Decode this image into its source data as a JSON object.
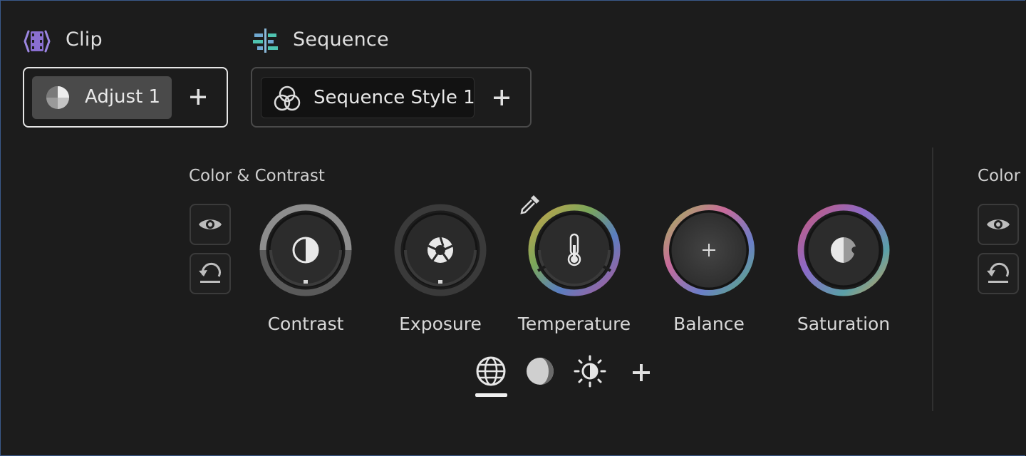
{
  "header": {
    "clip_label": "Clip",
    "sequence_label": "Sequence"
  },
  "clip_group": {
    "chip_label": "Adjust 1",
    "add_label": "+"
  },
  "sequence_group": {
    "chip_label": "Sequence Style 1",
    "add_label": "+"
  },
  "section": {
    "title": "Color & Contrast",
    "right_title": "Color S"
  },
  "dials": [
    {
      "label": "Contrast",
      "icon": "contrast-icon"
    },
    {
      "label": "Exposure",
      "icon": "aperture-icon"
    },
    {
      "label": "Temperature",
      "icon": "thermometer-icon"
    },
    {
      "label": "Balance",
      "icon": "plus-icon"
    },
    {
      "label": "Saturation",
      "icon": "saturation-icon"
    }
  ],
  "tabs": [
    {
      "icon": "globe-icon",
      "selected": true
    },
    {
      "icon": "half-moon-icon",
      "selected": false
    },
    {
      "icon": "sun-icon",
      "selected": false
    },
    {
      "icon": "add-icon",
      "selected": false
    }
  ],
  "colors": {
    "background": "#1c1c1c",
    "accent_clip": "#8a6fd1",
    "accent_sequence": "#4fc3b0"
  }
}
